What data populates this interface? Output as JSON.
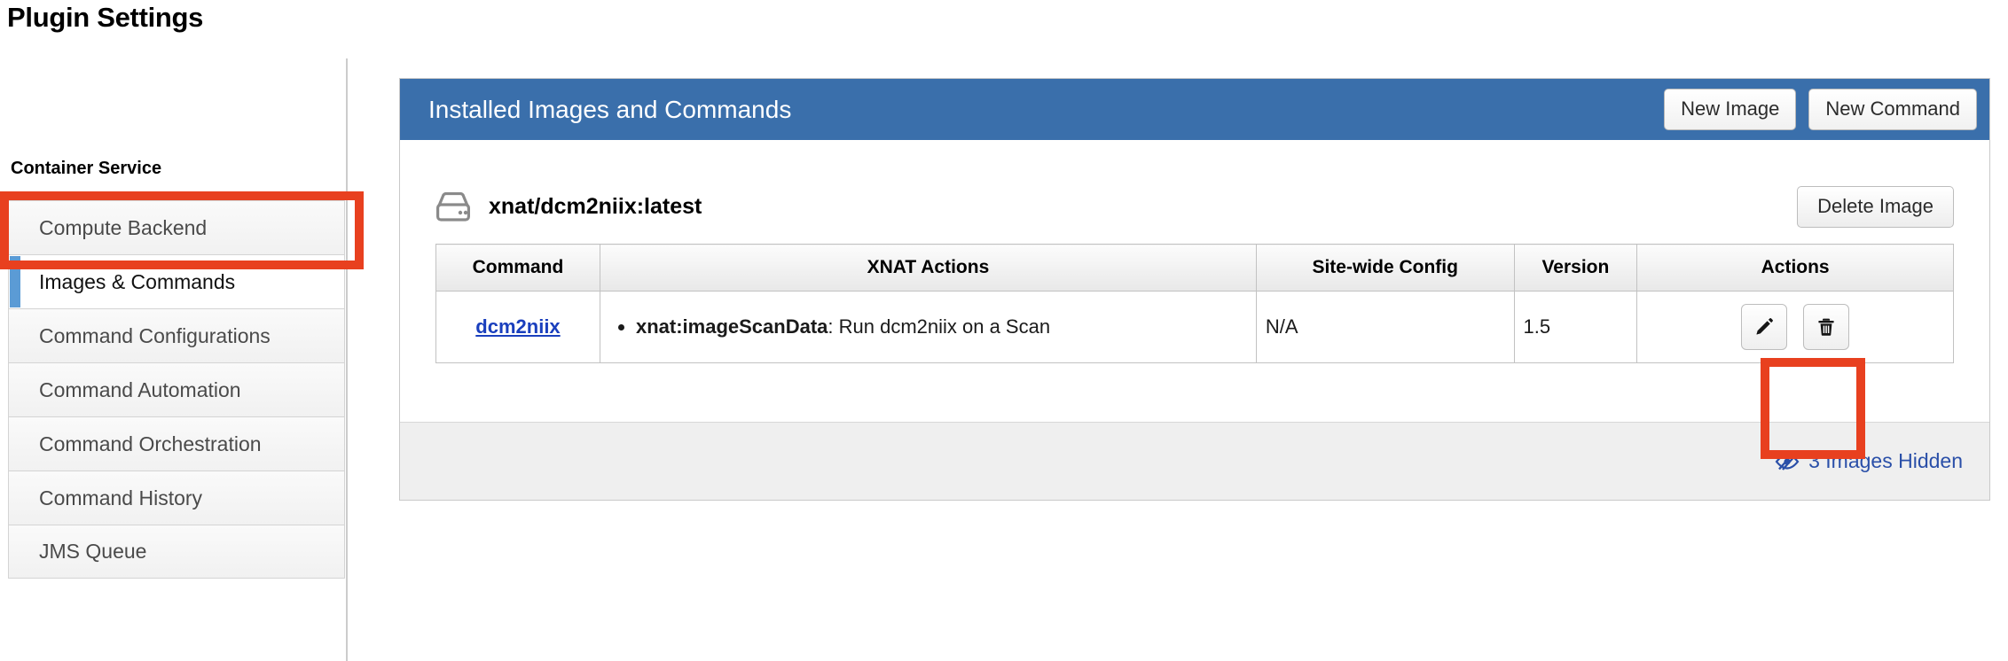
{
  "page": {
    "title": "Plugin Settings"
  },
  "sidebar": {
    "heading": "Container Service",
    "items": [
      {
        "label": "Compute Backend",
        "active": false
      },
      {
        "label": "Images & Commands",
        "active": true
      },
      {
        "label": "Command Configurations",
        "active": false
      },
      {
        "label": "Command Automation",
        "active": false
      },
      {
        "label": "Command Orchestration",
        "active": false
      },
      {
        "label": "Command History",
        "active": false
      },
      {
        "label": "JMS Queue",
        "active": false
      }
    ]
  },
  "panel": {
    "title": "Installed Images and Commands",
    "header_buttons": [
      {
        "label": "New Image",
        "name": "new-image-button"
      },
      {
        "label": "New Command",
        "name": "new-command-button"
      }
    ],
    "image": {
      "icon": "hdd-icon",
      "name": "xnat/dcm2niix:latest",
      "delete_label": "Delete Image"
    },
    "table": {
      "columns": [
        "Command",
        "XNAT Actions",
        "Site-wide Config",
        "Version",
        "Actions"
      ],
      "rows": [
        {
          "command": "dcm2niix",
          "xnat_actions": [
            {
              "target": "xnat:imageScanData",
              "description": ": Run dcm2niix on a Scan"
            }
          ],
          "site_wide_config": "N/A",
          "version": "1.5",
          "actions": [
            {
              "name": "edit-command-button",
              "icon": "pencil-icon"
            },
            {
              "name": "delete-command-button",
              "icon": "trash-icon"
            }
          ]
        }
      ]
    },
    "footer": {
      "hidden_images_icon": "eye-slash-icon",
      "hidden_images_label": "3 Images Hidden"
    }
  },
  "annotations": {
    "accent_color": "#e8401f",
    "boxes": [
      {
        "name": "highlight-images-and-commands",
        "target": "sidebar-item-images-commands"
      },
      {
        "name": "highlight-delete-command",
        "target": "delete-command-button"
      }
    ]
  },
  "colors": {
    "panel_header_blue": "#3a6fab",
    "active_marker_blue": "#5b9bd5",
    "link_blue": "#1a3fbd",
    "footer_link_blue": "#2a4fa8",
    "annotation_red": "#e8401f"
  }
}
